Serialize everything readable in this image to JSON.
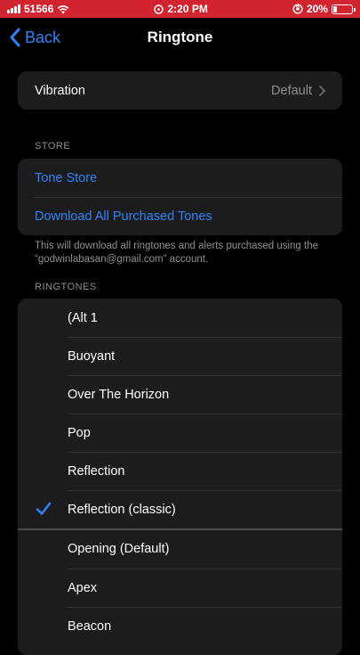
{
  "status_bar": {
    "carrier": "51566",
    "time": "2:20 PM",
    "battery": "20%",
    "battery_level": 0.2,
    "background": "#d1242f"
  },
  "nav": {
    "back_label": "Back",
    "title": "Ringtone"
  },
  "vibration": {
    "label": "Vibration",
    "value": "Default"
  },
  "store": {
    "header": "STORE",
    "tone_store": "Tone Store",
    "download_all": "Download All Purchased Tones",
    "footer": "This will download all ringtones and alerts purchased using the “godwinlabasan@gmail.com” account."
  },
  "ringtones": {
    "header": "RINGTONES",
    "items": [
      {
        "label": "(Alt 1",
        "selected": false
      },
      {
        "label": "Buoyant",
        "selected": false
      },
      {
        "label": "Over The Horizon",
        "selected": false
      },
      {
        "label": "Pop",
        "selected": false
      },
      {
        "label": "Reflection",
        "selected": false
      },
      {
        "label": "Reflection (classic)",
        "selected": true
      },
      {
        "label": "Opening (Default)",
        "selected": false
      },
      {
        "label": "Apex",
        "selected": false
      },
      {
        "label": "Beacon",
        "selected": false
      }
    ]
  },
  "colors": {
    "accent": "#2f83f7",
    "cell": "#1c1c1e",
    "secondary_text": "#8e8e93"
  }
}
